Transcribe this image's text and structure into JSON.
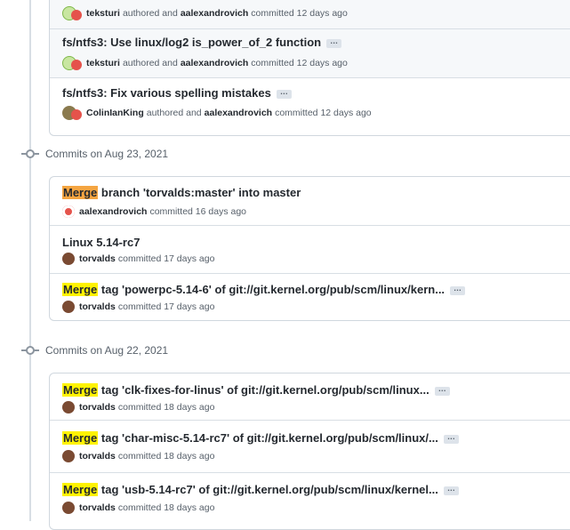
{
  "top_box": {
    "rows": [
      {
        "title": "",
        "author": "teksturi",
        "authored": "authored and",
        "committer": "aalexandrovich",
        "committed": "committed 12 days ago"
      },
      {
        "title": "fs/ntfs3: Use linux/log2 is_power_of_2 function",
        "author": "teksturi",
        "authored": "authored and",
        "committer": "aalexandrovich",
        "committed": "committed 12 days ago"
      },
      {
        "title": "fs/ntfs3: Fix various spelling mistakes",
        "author": "ColinIanKing",
        "authored": "authored and",
        "committer": "aalexandrovich",
        "committed": "committed 12 days ago"
      }
    ]
  },
  "groups": [
    {
      "heading": "Commits on Aug 23, 2021",
      "rows": [
        {
          "merge": "Merge",
          "title": " branch 'torvalds:master' into master",
          "committer": "aalexandrovich",
          "committed": "committed 16 days ago"
        },
        {
          "title": "Linux 5.14-rc7",
          "committer": "torvalds",
          "committed": "committed 17 days ago"
        },
        {
          "merge": "Merge",
          "title": " tag 'powerpc-5.14-6' of git://git.kernel.org/pub/scm/linux/kern...",
          "committer": "torvalds",
          "committed": "committed 17 days ago"
        }
      ]
    },
    {
      "heading": "Commits on Aug 22, 2021",
      "rows": [
        {
          "merge": "Merge",
          "title": " tag 'clk-fixes-for-linus' of git://git.kernel.org/pub/scm/linux...",
          "committer": "torvalds",
          "committed": "committed 18 days ago"
        },
        {
          "merge": "Merge",
          "title": " tag 'char-misc-5.14-rc7' of git://git.kernel.org/pub/scm/linux/...",
          "committer": "torvalds",
          "committed": "committed 18 days ago"
        },
        {
          "merge": "Merge",
          "title": " tag 'usb-5.14-rc7' of git://git.kernel.org/pub/scm/linux/kernel...",
          "committer": "torvalds",
          "committed": "committed 18 days ago"
        }
      ]
    }
  ],
  "ellipsis_label": "…",
  "colors": {
    "merge_orange": "#f5a541",
    "merge_yellow": "#fff300",
    "border": "#d0d7de"
  }
}
